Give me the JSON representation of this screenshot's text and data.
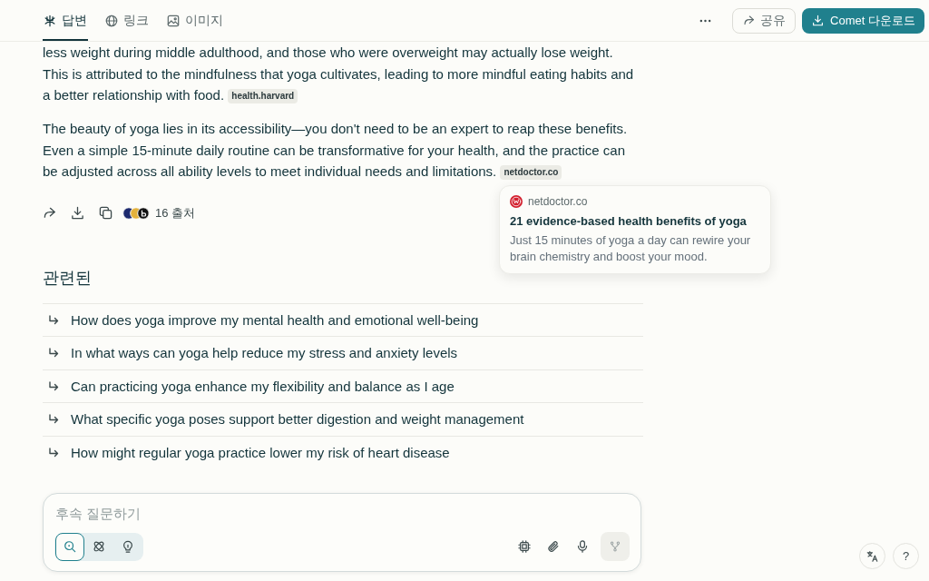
{
  "header": {
    "tabs": [
      {
        "label": "답변",
        "selected": true
      },
      {
        "label": "링크",
        "selected": false
      },
      {
        "label": "이미지",
        "selected": false
      }
    ],
    "share_button": {
      "label": "공유"
    },
    "download_button": {
      "label": "Comet 다운로드"
    }
  },
  "answer": {
    "paragraphs": [
      {
        "text": "less weight during middle adulthood, and those who were overweight may actually lose weight. This is attributed to the mindfulness that yoga cultivates, leading to more mindful eating habits and a better relationship with food.",
        "citation": "health.harvard"
      },
      {
        "text": "The beauty of yoga lies in its accessibility—you don't need to be an expert to reap these benefits. Even a simple 15-minute daily routine can be transformative for your health, and the practice can be adjusted across all ability levels to meet individual needs and limitations.",
        "citation": "netdoctor.co"
      }
    ],
    "sources_label": "16 출처"
  },
  "citation_card": {
    "domain": "netdoctor.co",
    "title": "21 evidence-based health benefits of yoga",
    "snippet": "Just 15 minutes of yoga a day can rewire your brain chemistry and boost your mood."
  },
  "related": {
    "heading": "관련된",
    "items": [
      "How does yoga improve my mental health and emotional well-being",
      "In what ways can yoga help reduce my stress and anxiety levels",
      "Can practicing yoga enhance my flexibility and balance as I age",
      "What specific yoga poses support better digestion and weight management",
      "How might regular yoga practice lower my risk of heart disease"
    ]
  },
  "composer": {
    "placeholder": "후속 질문하기",
    "modes": [
      {
        "selected": true
      },
      {
        "selected": false
      },
      {
        "selected": false
      }
    ],
    "send_disabled": true
  },
  "help_button": {
    "label": "?"
  }
}
